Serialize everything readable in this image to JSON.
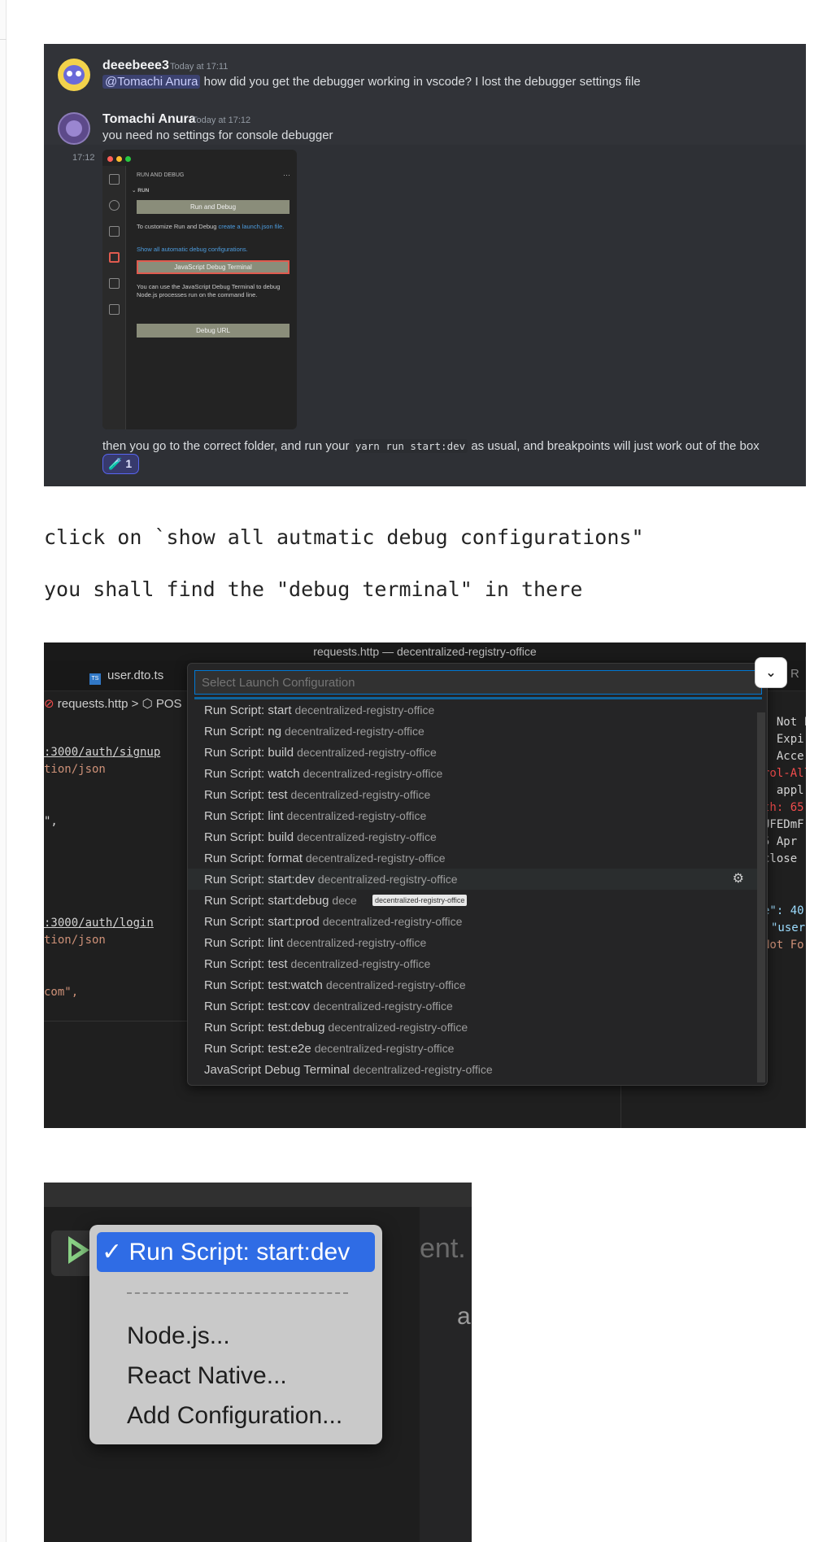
{
  "discord": {
    "messages": [
      {
        "author": "deeebeee3",
        "time": "Today at 17:11",
        "mention": "@Tomachi Anura",
        "text": " how did you get the debugger working in vscode? I lost the debugger settings file"
      },
      {
        "author": "Tomachi Anura",
        "time": "Today at 17:12",
        "text": "you need no settings for console debugger"
      }
    ],
    "followup_time": "17:12",
    "followup_before": "then you go to the correct folder, and run your ",
    "followup_code": "yarn run start:dev",
    "followup_after": " as usual, and breakpoints will just work out of the box",
    "reaction_emoji": "🧪",
    "reaction_count": "1",
    "embed": {
      "header": "RUN AND DEBUG",
      "dots": "···",
      "section": "RUN",
      "run_button": "Run and Debug",
      "customize_text": "To customize Run and Debug ",
      "customize_link": "create a launch.json file.",
      "show_all_link": "Show all automatic debug configurations.",
      "js_terminal_button": "JavaScript Debug Terminal",
      "terminal_desc": "You can use the JavaScript Debug Terminal to debug Node.js processes run on the command line.",
      "debug_url_button": "Debug URL"
    }
  },
  "notes": {
    "line1": "click on `show all autmatic debug configurations\"",
    "line2": "you shall find the \"debug terminal\" in there"
  },
  "launch": {
    "window_title": "requests.http — decentralized-registry-office",
    "tab_label": "user.dto.ts",
    "tab_badge": "TS",
    "right_tab": "R",
    "breadcrumb_file": "requests.http",
    "breadcrumb_sep": ">",
    "breadcrumb_symbol": "POS",
    "placeholder": "Select Launch Configuration",
    "tooltip": "decentralized-registry-office",
    "gear": "⚙",
    "chevron": "⌄",
    "items": [
      {
        "label": "Run Script: start",
        "desc": "decentralized-registry-office"
      },
      {
        "label": "Run Script: ng",
        "desc": "decentralized-registry-office"
      },
      {
        "label": "Run Script: build",
        "desc": "decentralized-registry-office"
      },
      {
        "label": "Run Script: watch",
        "desc": "decentralized-registry-office"
      },
      {
        "label": "Run Script: test",
        "desc": "decentralized-registry-office"
      },
      {
        "label": "Run Script: lint",
        "desc": "decentralized-registry-office"
      },
      {
        "label": "Run Script: build",
        "desc": "decentralized-registry-office"
      },
      {
        "label": "Run Script: format",
        "desc": "decentralized-registry-office"
      },
      {
        "label": "Run Script: start:dev",
        "desc": "decentralized-registry-office"
      },
      {
        "label": "Run Script: start:debug",
        "desc": "dece",
        "desc_tail": "ice"
      },
      {
        "label": "Run Script: start:prod",
        "desc": "decentralized-registry-office"
      },
      {
        "label": "Run Script: lint",
        "desc": "decentralized-registry-office"
      },
      {
        "label": "Run Script: test",
        "desc": "decentralized-registry-office"
      },
      {
        "label": "Run Script: test:watch",
        "desc": "decentralized-registry-office"
      },
      {
        "label": "Run Script: test:cov",
        "desc": "decentralized-registry-office"
      },
      {
        "label": "Run Script: test:debug",
        "desc": "decentralized-registry-office"
      },
      {
        "label": "Run Script: test:e2e",
        "desc": "decentralized-registry-office"
      },
      {
        "label": "JavaScript Debug Terminal",
        "desc": "decentralized-registry-office"
      }
    ],
    "code_left": {
      "url1": ":3000/auth/signup",
      "ct1": "tion/json",
      "q1": "\",",
      "url2": ":3000/auth/login",
      "ct2": "tion/json",
      "com": "com\","
    },
    "code_right": {
      "r1": ": Not F",
      "r2": ": Expi",
      "r3": ", Acce",
      "r4": "rol-All",
      "r5": ": appl",
      "r6": "th: 65",
      "r7": "UFEDmF",
      "r8": "5 Apr",
      "r9": "close",
      "r10": "e\": 40",
      "r11": "\"user",
      "r12": "Not Fo"
    }
  },
  "dropdown": {
    "selected": "✓ Run Script: start:dev",
    "items": [
      "Node.js...",
      "React Native...",
      "Add Configuration..."
    ],
    "ghost_text": "ent.",
    "ghost_text2": "a"
  }
}
